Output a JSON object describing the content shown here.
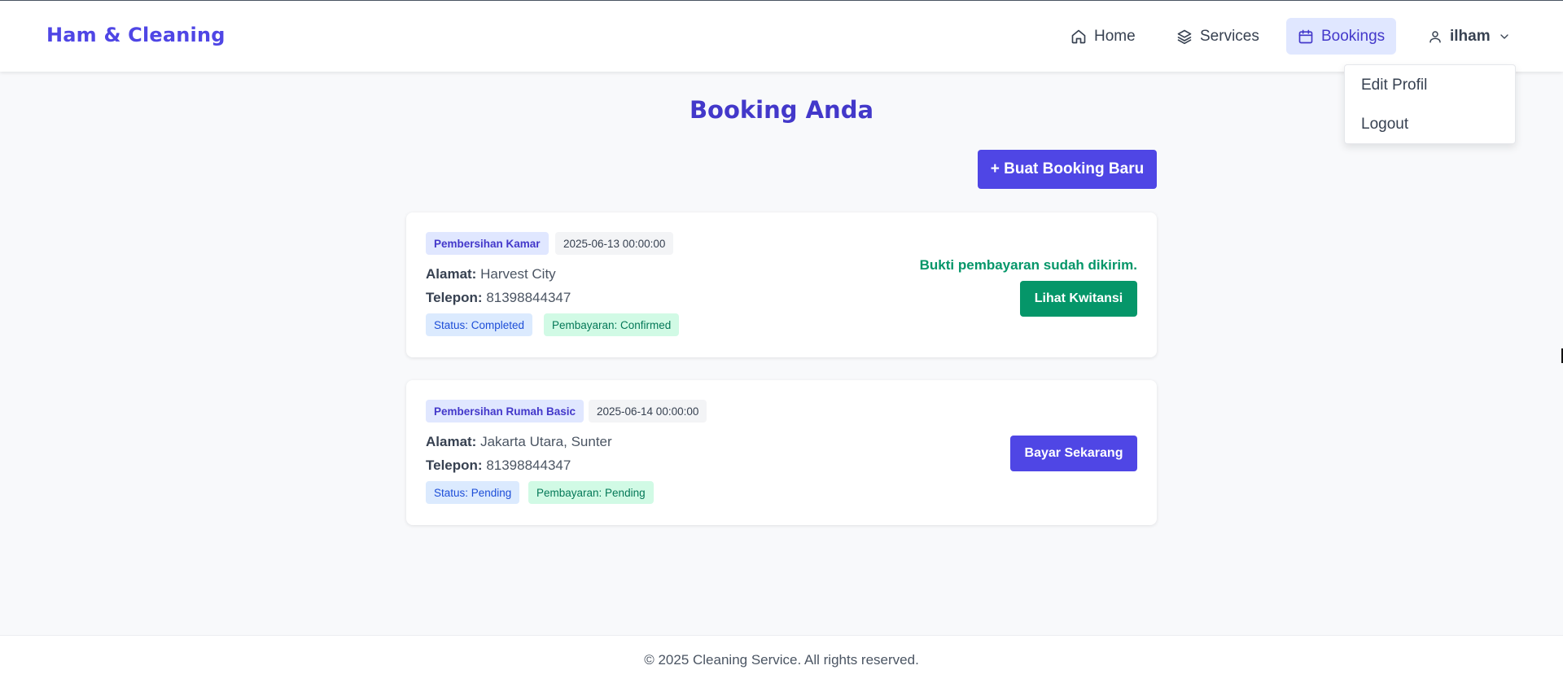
{
  "header": {
    "brand": "Ham & Cleaning",
    "nav": {
      "home": "Home",
      "services": "Services",
      "bookings": "Bookings",
      "user": "ilham"
    },
    "user_menu": {
      "edit_profile": "Edit Profil",
      "logout": "Logout"
    }
  },
  "main": {
    "title": "Booking Anda",
    "new_booking_label": "+ Buat Booking Baru",
    "address_label": "Alamat:",
    "phone_label": "Telepon:",
    "bookings": [
      {
        "service": "Pembersihan Kamar",
        "date": "2025-06-13 00:00:00",
        "address": "Harvest City",
        "phone": "81398844347",
        "status": "Status: Completed",
        "payment": "Pembayaran: Confirmed",
        "proof_text": "Bukti pembayaran sudah dikirim.",
        "action_label": "Lihat Kwitansi"
      },
      {
        "service": "Pembersihan Rumah Basic",
        "date": "2025-06-14 00:00:00",
        "address": "Jakarta Utara, Sunter",
        "phone": "81398844347",
        "status": "Status: Pending",
        "payment": "Pembayaran: Pending",
        "action_label": "Bayar Sekarang"
      }
    ]
  },
  "footer": {
    "text": "© 2025 Cleaning Service. All rights reserved."
  },
  "colors": {
    "brand": "#4f46e5",
    "title": "#4338ca",
    "success": "#059669",
    "background": "#f8f9fb"
  },
  "icons": {
    "home": "home-icon",
    "services": "layers-icon",
    "bookings": "calendar-icon",
    "user": "user-icon",
    "dropdown": "chevron-down-icon"
  }
}
